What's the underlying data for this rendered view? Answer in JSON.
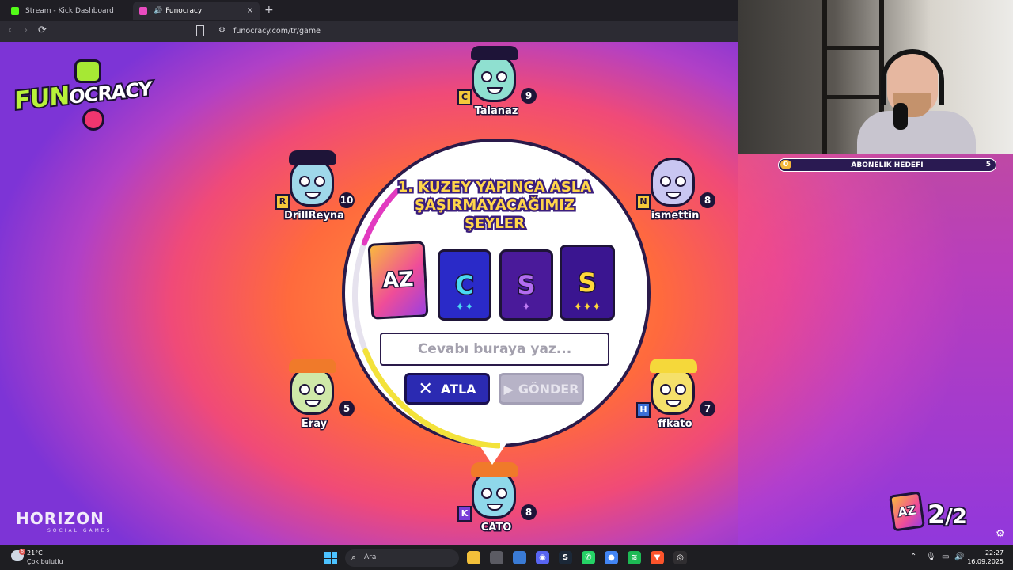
{
  "browser": {
    "tabs": [
      {
        "label": "Stream - Kick Dashboard",
        "color": "#53fc18"
      },
      {
        "label": "Funocracy",
        "color": "#e94cc0"
      }
    ],
    "new_tab_symbol": "+",
    "close_symbol": "×",
    "back_symbol": "‹",
    "forward_symbol": "›",
    "reload_symbol": "⟳",
    "url": "funocracy.com/tr/game"
  },
  "game": {
    "logo": {
      "part1": "FUN",
      "part2": "OCRACY"
    },
    "question": "1. KUZEY YAPINCA ASLA ŞAŞIRMAYACAĞIMIZ ŞEYLER",
    "cards": [
      {
        "id": "az",
        "text": "AZ",
        "stars": ""
      },
      {
        "id": "c",
        "text": "C",
        "stars": "✦✦"
      },
      {
        "id": "s1",
        "text": "S",
        "stars": "✦"
      },
      {
        "id": "s2",
        "text": "S",
        "stars": "✦✦✦"
      }
    ],
    "answer_placeholder": "Cevabı buraya yaz...",
    "skip_label": "ATLA",
    "skip_icon": "✕",
    "send_label": "GÖNDER",
    "send_icon": "▶",
    "timer_fraction": 0.5,
    "players": [
      {
        "name": "Talanaz",
        "score": "9",
        "letter": "C",
        "color": "#8fe0d0"
      },
      {
        "name": "DrillReyna",
        "score": "10",
        "letter": "R",
        "color": "#9fd8ea"
      },
      {
        "name": "ismettin",
        "score": "8",
        "letter": "N",
        "color": "#c9c6f2"
      },
      {
        "name": "Eray",
        "score": "5",
        "letter": "",
        "color": "#cfe8a8"
      },
      {
        "name": "ffkato",
        "score": "7",
        "letter": "H",
        "color": "#f5e06a"
      },
      {
        "name": "CATO",
        "score": "8",
        "letter": "K",
        "color": "#8fd8ea"
      }
    ],
    "brand": {
      "name": "HORIZON",
      "sub": "SOCIAL GAMES"
    },
    "round": {
      "icon": "AZ",
      "current": "2",
      "total": "/2"
    },
    "settings_icon": "⚙"
  },
  "stream": {
    "sub_goal": {
      "current": "0",
      "label": "ABONELIK HEDEFI",
      "target": "5"
    }
  },
  "taskbar": {
    "weather": {
      "badge": "6",
      "temp": "21°C",
      "desc": "Çok bulutlu"
    },
    "search_icon": "⌕",
    "search_label": "Ara",
    "apps": [
      {
        "name": "file-explorer",
        "color": "#f3c03a",
        "glyph": ""
      },
      {
        "name": "task-view",
        "color": "#5b5b63",
        "glyph": ""
      },
      {
        "name": "store",
        "color": "#3a7bd5",
        "glyph": ""
      },
      {
        "name": "discord",
        "color": "#5865f2",
        "glyph": "◉"
      },
      {
        "name": "steam",
        "color": "#1b2838",
        "glyph": "S"
      },
      {
        "name": "whatsapp",
        "color": "#25d366",
        "glyph": "✆"
      },
      {
        "name": "chrome",
        "color": "#4285f4",
        "glyph": "●"
      },
      {
        "name": "spotify",
        "color": "#1db954",
        "glyph": "≋"
      },
      {
        "name": "brave",
        "color": "#fb542b",
        "glyph": "▼"
      },
      {
        "name": "obs",
        "color": "#302e31",
        "glyph": "◎"
      }
    ],
    "tray": [
      "⌃",
      "🎙",
      "▭",
      "🔊"
    ],
    "time": "22:27",
    "date": "16.09.2025"
  }
}
